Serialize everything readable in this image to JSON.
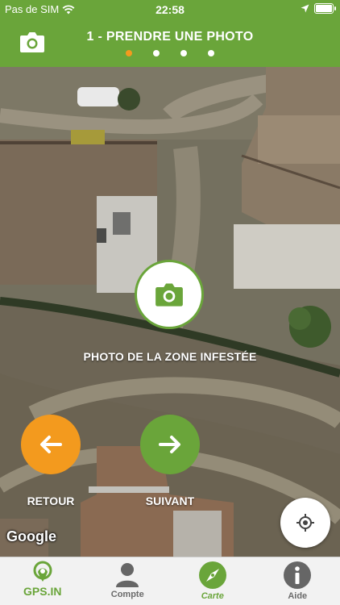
{
  "status_bar": {
    "carrier": "Pas de SIM",
    "time": "22:58"
  },
  "header": {
    "title": "1 - PRENDRE UNE PHOTO",
    "steps": 4,
    "current_step": 1
  },
  "map": {
    "attribution": "Google"
  },
  "actions": {
    "photo_label": "PHOTO DE LA ZONE INFESTÉE",
    "back_label": "RETOUR",
    "next_label": "SUIVANT"
  },
  "tabbar": {
    "logo": "GPS.IN",
    "items": [
      {
        "label": "Compte",
        "icon": "user-icon"
      },
      {
        "label": "Carte",
        "icon": "compass-icon",
        "active": true
      },
      {
        "label": "Aide",
        "icon": "info-icon"
      }
    ]
  },
  "colors": {
    "brand_green": "#6aa53a",
    "accent_orange": "#f39a1e"
  }
}
